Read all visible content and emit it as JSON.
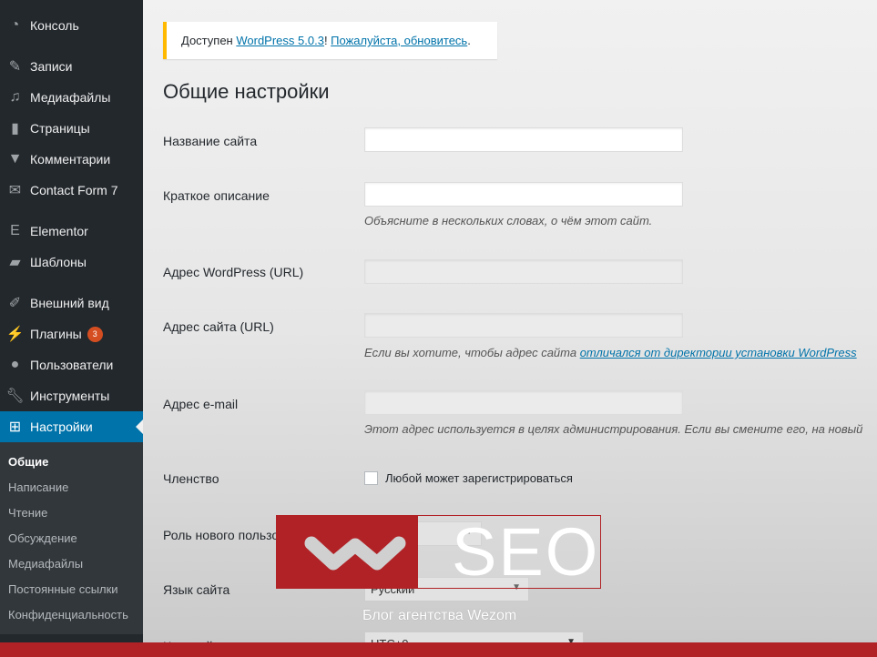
{
  "sidebar": {
    "items": [
      {
        "label": "Консоль",
        "icon": "dashboard-icon"
      },
      {
        "label": "Записи",
        "icon": "pin-icon"
      },
      {
        "label": "Медиафайлы",
        "icon": "media-icon"
      },
      {
        "label": "Страницы",
        "icon": "pages-icon"
      },
      {
        "label": "Комментарии",
        "icon": "comment-icon"
      },
      {
        "label": "Contact Form 7",
        "icon": "mail-icon"
      },
      {
        "label": "Elementor",
        "icon": "elementor-icon"
      },
      {
        "label": "Шаблоны",
        "icon": "folder-icon"
      },
      {
        "label": "Внешний вид",
        "icon": "brush-icon"
      },
      {
        "label": "Плагины",
        "icon": "plugin-icon",
        "badge": "3"
      },
      {
        "label": "Пользователи",
        "icon": "user-icon"
      },
      {
        "label": "Инструменты",
        "icon": "wrench-icon"
      },
      {
        "label": "Настройки",
        "icon": "settings-icon",
        "active": true
      }
    ],
    "submenu": [
      "Общие",
      "Написание",
      "Чтение",
      "Обсуждение",
      "Медиафайлы",
      "Постоянные ссылки",
      "Конфиденциальность"
    ]
  },
  "notice": {
    "prefix": "Доступен ",
    "link1": "WordPress 5.0.3",
    "mid": "! ",
    "link2": "Пожалуйста, обновитесь",
    "suffix": "."
  },
  "page_title": "Общие настройки",
  "fields": {
    "site_name": {
      "label": "Название сайта",
      "value": ""
    },
    "tagline": {
      "label": "Краткое описание",
      "value": "",
      "desc": "Объясните в нескольких словах, о чём этот сайт."
    },
    "wp_url": {
      "label": "Адрес WordPress (URL)",
      "value": ""
    },
    "site_url": {
      "label": "Адрес сайта (URL)",
      "value": "",
      "desc_prefix": "Если вы хотите, чтобы адрес сайта ",
      "desc_link": "отличался от директории установки WordPress"
    },
    "email": {
      "label": "Адрес e-mail",
      "value": "",
      "desc": "Этот адрес используется в целях администрирования. Если вы смените его, на новый"
    },
    "membership": {
      "label": "Членство",
      "checkbox": "Любой может зарегистрироваться",
      "checked": false
    },
    "role": {
      "label": "Роль нового пользователя"
    },
    "language": {
      "label": "Язык сайта",
      "value": "Русский"
    },
    "timezone": {
      "label": "Часовой пояс",
      "value": "UTC+0"
    }
  },
  "watermark": {
    "text": "SEO",
    "subtitle": "Блог агентства Wezom",
    "color": "#b02226"
  },
  "colors": {
    "sidebar": "#23282d",
    "active": "#0073aa",
    "accent": "#b02226"
  }
}
